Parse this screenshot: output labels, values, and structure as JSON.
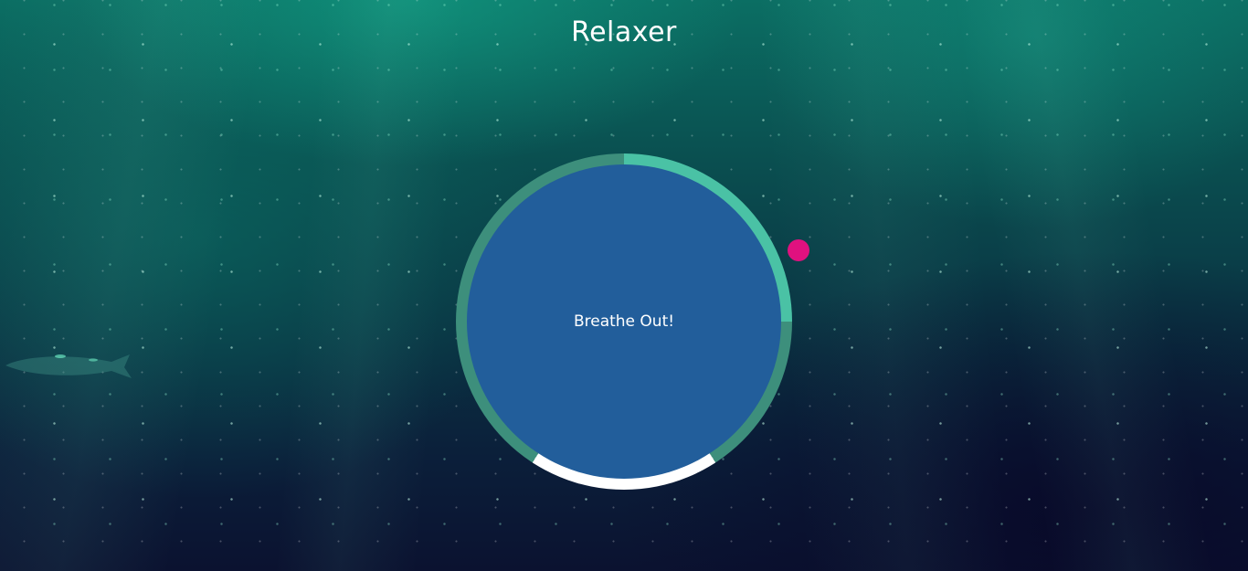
{
  "app": {
    "title": "Relaxer"
  },
  "breathing": {
    "instruction": "Breathe Out!"
  },
  "colors": {
    "ring_inhale": "#4ac2a5",
    "ring_hold": "#3d8f7c",
    "ring_exhale": "#ffffff",
    "circle": "#225e9b",
    "pointer": "#e0117f"
  }
}
